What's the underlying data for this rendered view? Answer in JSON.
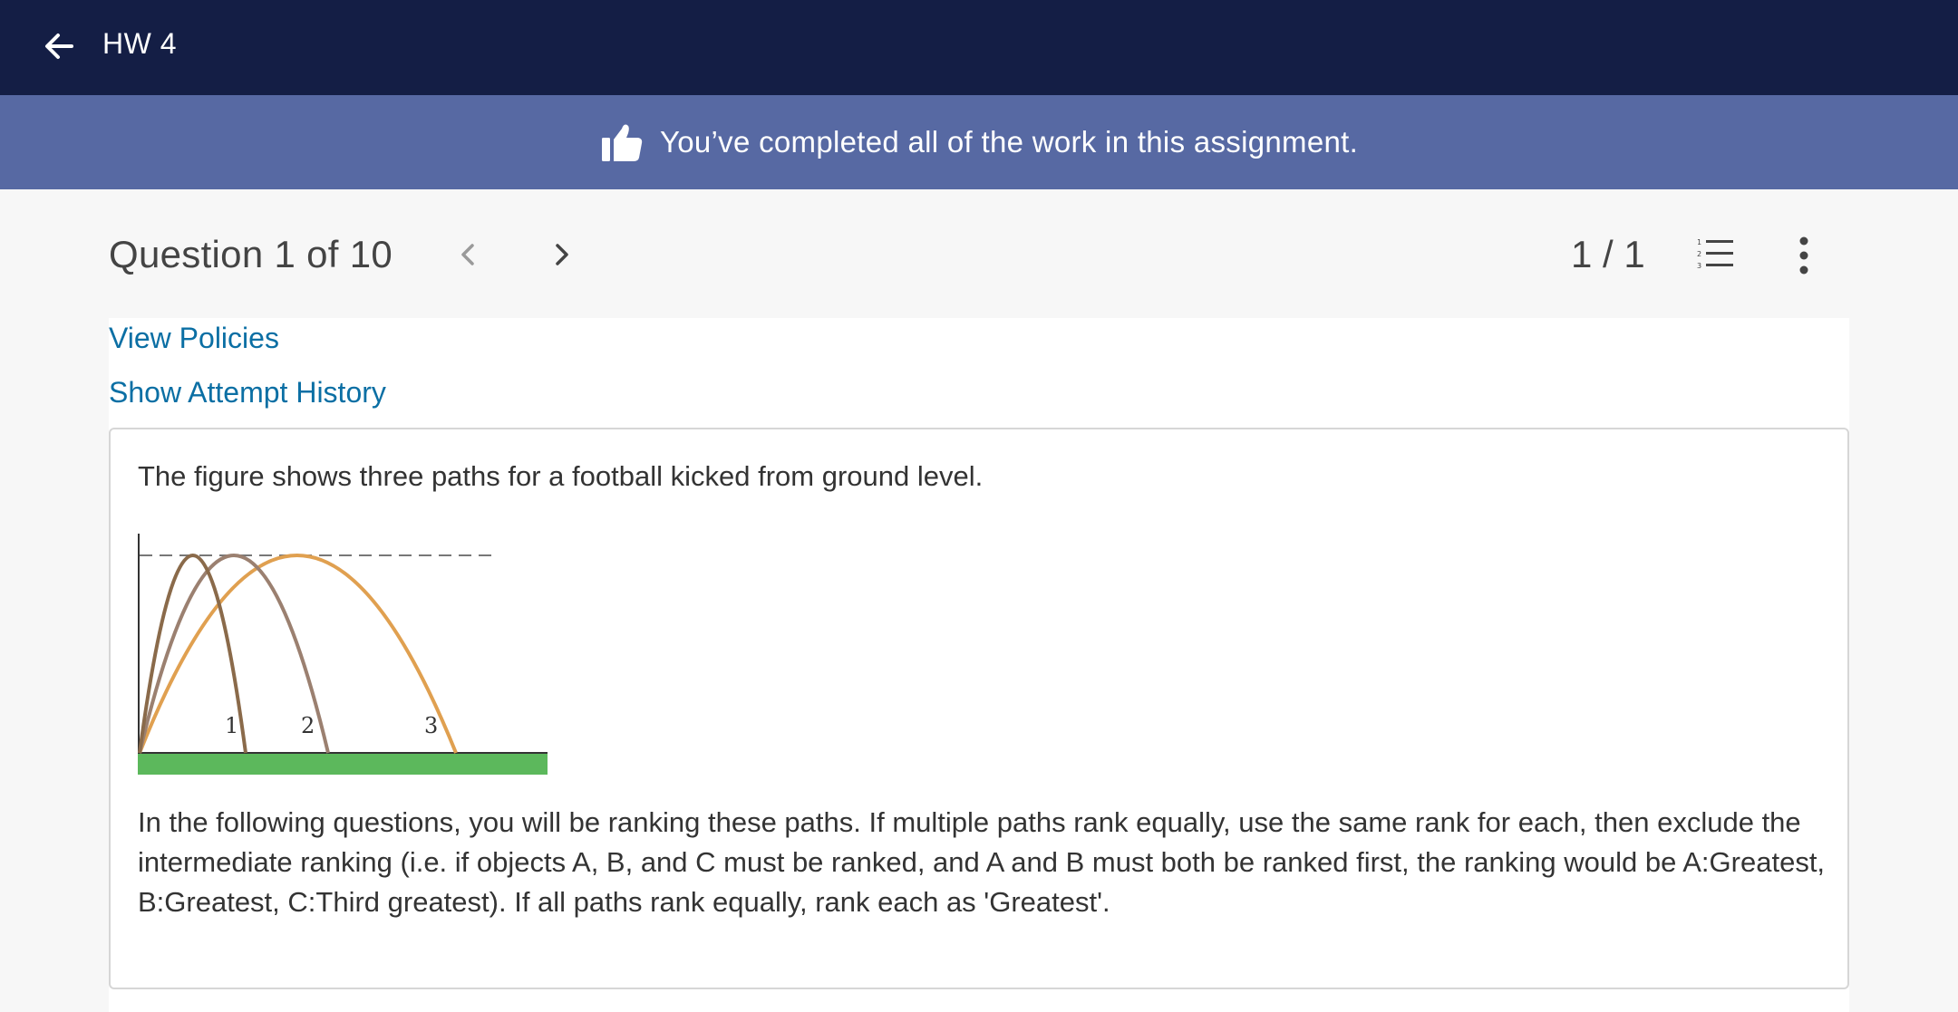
{
  "topbar": {
    "title": "HW 4",
    "back_icon": "arrow-left-icon"
  },
  "banner": {
    "text": "You’ve completed all of the work in this assignment.",
    "icon": "thumbs-up-icon"
  },
  "question_header": {
    "title": "Question 1 of 10",
    "score": "1 / 1",
    "prev_icon": "chevron-left-icon",
    "next_icon": "chevron-right-icon",
    "list_icon": "numbered-list-icon",
    "more_icon": "more-vertical-icon"
  },
  "links": {
    "view_policies": "View Policies",
    "show_attempt_history": "Show Attempt History"
  },
  "question": {
    "intro": "The figure shows three paths for a football kicked from ground level.",
    "figure_labels": [
      "1",
      "2",
      "3"
    ],
    "instructions": "In the following questions, you will be ranking these paths. If multiple paths rank equally, use the same rank for each, then exclude the intermediate ranking (i.e. if objects A, B, and C must be ranked, and A and B must both be ranked first, the ranking would be A:Greatest, B:Greatest, C:Third greatest). If all paths rank equally, rank each as 'Greatest'."
  },
  "colors": {
    "topbar": "#141e45",
    "banner": "#5769a3",
    "link": "#0b6fa4",
    "ground": "#5cb85c",
    "path1": "#8a6a4a",
    "path2": "#9b8070",
    "path3": "#e0a050"
  }
}
